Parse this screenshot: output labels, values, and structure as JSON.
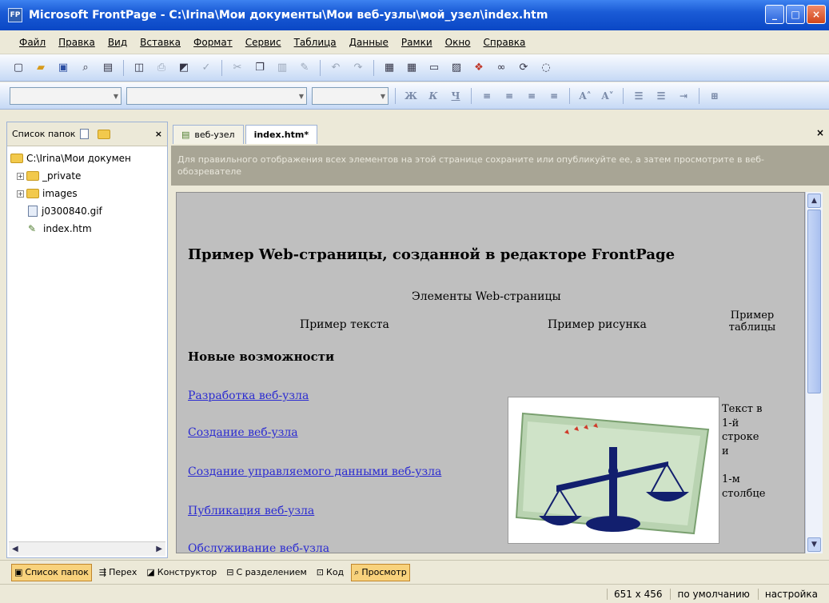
{
  "window": {
    "title": "Microsoft FrontPage - C:\\Irina\\Мои документы\\Мои веб-узлы\\мой_узел\\index.htm"
  },
  "menu": [
    "Файл",
    "Правка",
    "Вид",
    "Вставка",
    "Формат",
    "Сервис",
    "Таблица",
    "Данные",
    "Рамки",
    "Окно",
    "Справка"
  ],
  "folder_panel": {
    "title": "Список папок",
    "root": "C:\\Irina\\Мои докумен",
    "items": [
      "_private",
      "images",
      "j0300840.gif",
      "index.htm"
    ]
  },
  "tabs": {
    "site_tab": "веб-узел",
    "file_tab": "index.htm*"
  },
  "notice": "Для правильного отображения всех элементов на этой странице сохраните или опубликуйте ее, а затем просмотрите в веб-обозревателе",
  "page": {
    "heading": "Пример Web-страницы, созданной в редакторе FrontPage",
    "subheading": "Элементы Web-страницы",
    "col_text": "Пример текста",
    "col_picture": "Пример рисунка",
    "col_table": "Пример таблицы",
    "new_features": "Новые возможности",
    "links": [
      "Разработка веб-узла",
      "Создание веб-узла",
      "Создание управляемого данными веб-узла",
      "Публикация веб-узла",
      "Обслуживание веб-узла"
    ],
    "cell_text": [
      "Текст в",
      "1-й",
      "строке",
      "и",
      "1-м",
      "столбце"
    ]
  },
  "viewbar": {
    "folders": "Список папок",
    "nav": "Перех",
    "design": "Конструктор",
    "split": "С разделением",
    "code": "Код",
    "preview": "Просмотр"
  },
  "status": {
    "size": "651 x 456",
    "default": "по умолчанию",
    "custom": "настройка"
  }
}
